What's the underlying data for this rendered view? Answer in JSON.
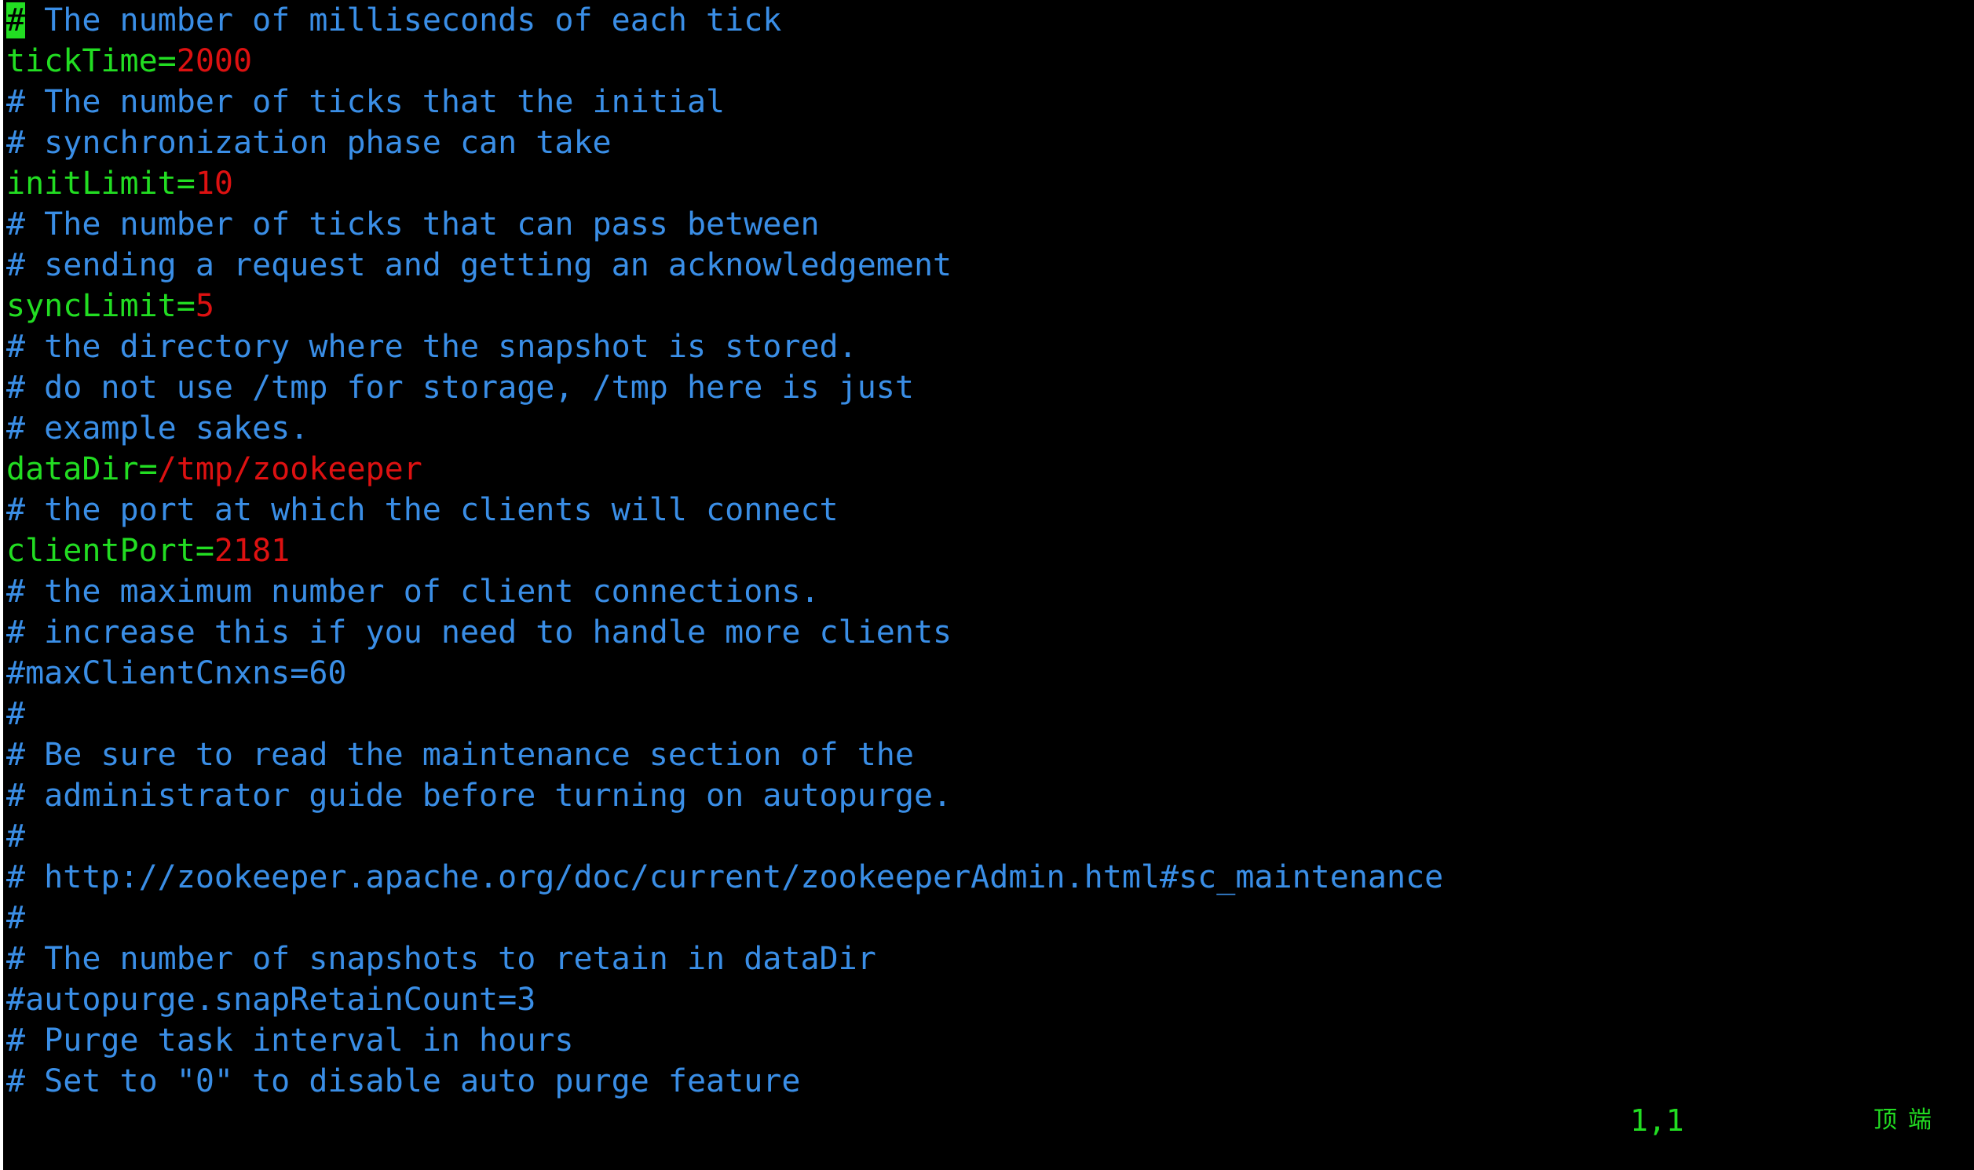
{
  "editor": {
    "colors": {
      "background": "#000000",
      "comment": "#3a8ee6",
      "key": "#22dd22",
      "value": "#dd1111",
      "cursor": "#22dd22"
    },
    "lines": [
      {
        "type": "cursor_comment",
        "cursor": "#",
        "text": " The number of milliseconds of each tick"
      },
      {
        "type": "kv",
        "key": "tickTime=",
        "value": "2000"
      },
      {
        "type": "comment",
        "text": "# The number of ticks that the initial"
      },
      {
        "type": "comment",
        "text": "# synchronization phase can take"
      },
      {
        "type": "kv",
        "key": "initLimit=",
        "value": "10"
      },
      {
        "type": "comment",
        "text": "# The number of ticks that can pass between"
      },
      {
        "type": "comment",
        "text": "# sending a request and getting an acknowledgement"
      },
      {
        "type": "kv",
        "key": "syncLimit=",
        "value": "5"
      },
      {
        "type": "comment",
        "text": "# the directory where the snapshot is stored."
      },
      {
        "type": "comment",
        "text": "# do not use /tmp for storage, /tmp here is just"
      },
      {
        "type": "comment",
        "text": "# example sakes."
      },
      {
        "type": "kv",
        "key": "dataDir=",
        "value": "/tmp/zookeeper"
      },
      {
        "type": "comment",
        "text": "# the port at which the clients will connect"
      },
      {
        "type": "kv",
        "key": "clientPort=",
        "value": "2181"
      },
      {
        "type": "comment",
        "text": "# the maximum number of client connections."
      },
      {
        "type": "comment",
        "text": "# increase this if you need to handle more clients"
      },
      {
        "type": "comment",
        "text": "#maxClientCnxns=60"
      },
      {
        "type": "comment",
        "text": "#"
      },
      {
        "type": "comment",
        "text": "# Be sure to read the maintenance section of the"
      },
      {
        "type": "comment",
        "text": "# administrator guide before turning on autopurge."
      },
      {
        "type": "comment",
        "text": "#"
      },
      {
        "type": "comment",
        "text": "# http://zookeeper.apache.org/doc/current/zookeeperAdmin.html#sc_maintenance"
      },
      {
        "type": "comment",
        "text": "#"
      },
      {
        "type": "comment",
        "text": "# The number of snapshots to retain in dataDir"
      },
      {
        "type": "comment",
        "text": "#autopurge.snapRetainCount=3"
      },
      {
        "type": "comment",
        "text": "# Purge task interval in hours"
      },
      {
        "type": "comment",
        "text": "# Set to \"0\" to disable auto purge feature"
      }
    ]
  },
  "statusline": {
    "ruler": "1,1",
    "position": "顶端"
  }
}
